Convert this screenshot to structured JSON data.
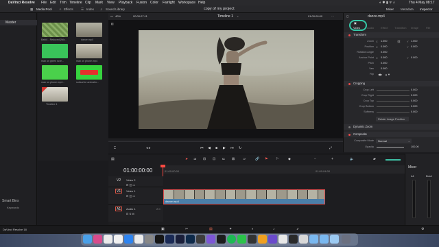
{
  "menubar": {
    "app_name": "DaVinci Resolve",
    "items": [
      "File",
      "Edit",
      "Trim",
      "Timeline",
      "Clip",
      "Mark",
      "View",
      "Playback",
      "Fusion",
      "Color",
      "Fairlight",
      "Workspace",
      "Help"
    ],
    "clock": "Thu 4 May  08:17"
  },
  "toolbar": {
    "media_pool": "Media Pool",
    "effects": "Effects",
    "index": "Index",
    "sound_library": "Sound Library",
    "project_title": "copy of my project",
    "mixer": "Mixer",
    "metadata": "Metadata",
    "inspector": "Inspector"
  },
  "bins": {
    "master": "Master",
    "smart_bins": "Smart Bins",
    "keywords": "Keywords"
  },
  "media_pool": {
    "clips": [
      {
        "label": "Bafd4 - Reduced [Wa...",
        "color": "#6b8f4a"
      },
      {
        "label": "dance.mp4",
        "color": "#9b9a8c"
      },
      {
        "label": "man on green scre...",
        "color": "#39c45a"
      },
      {
        "label": "man on phone.mp4",
        "color": "#b7b2a4"
      },
      {
        "label": "man on phone.mp4...",
        "color": "#4ad14b"
      },
      {
        "label": "subscribe animatio...",
        "color": "#37d23f"
      },
      {
        "label": "Timeline 1",
        "color": "#c9c6bc"
      }
    ]
  },
  "viewer": {
    "zoom": "40%",
    "source_tc": "00:00:07:11",
    "timeline_name": "Timeline 1",
    "record_tc": "01:00:00:00",
    "clip_name": "dance.mp4"
  },
  "inspector": {
    "tabs": [
      "Video",
      "Audio",
      "Effect",
      "Transition",
      "Image",
      "File"
    ],
    "active_tab": "Video",
    "transform_title": "Transform",
    "rows": [
      {
        "label": "Zoom",
        "x_label": "X",
        "x": "1.000",
        "y_label": "Y",
        "y": "1.000"
      },
      {
        "label": "Position",
        "x_label": "X",
        "x": "0.000",
        "y_label": "Y",
        "y": "0.000"
      },
      {
        "label": "Rotation Angle",
        "x": "0.000"
      },
      {
        "label": "Anchor Point",
        "x_label": "X",
        "x": "0.000",
        "y_label": "Y",
        "y": "0.000"
      },
      {
        "label": "Pitch",
        "x": "0.000"
      },
      {
        "label": "Yaw",
        "x": "0.000"
      },
      {
        "label": "Flip"
      }
    ],
    "cropping_title": "Cropping",
    "crop_rows": [
      {
        "label": "Crop Left",
        "x": "0.000"
      },
      {
        "label": "Crop Right",
        "x": "0.000"
      },
      {
        "label": "Crop Top",
        "x": "0.000"
      },
      {
        "label": "Crop Bottom",
        "x": "0.000"
      },
      {
        "label": "Softness",
        "x": "0.000"
      }
    ],
    "retain_label": "Retain Image Position",
    "dynamic_zoom_title": "Dynamic Zoom",
    "composite_title": "Composite",
    "composite_mode_label": "Composite Mode",
    "composite_mode_value": "Normal",
    "opacity_label": "Opacity",
    "opacity_value": "100.00",
    "highlight_color": "#35c9a8"
  },
  "timeline": {
    "timecode": "01:00:00:00",
    "ruler": [
      "01:00:00:00",
      "01:00:04:00"
    ],
    "tracks": [
      {
        "id": "V2",
        "name": "Video 2"
      },
      {
        "id": "V1",
        "name": "Video 1"
      },
      {
        "id": "A1",
        "name": "Audio 1",
        "level": "2.0"
      }
    ],
    "clip_name": "dance.mp4",
    "mixer_title": "Mixer",
    "mixer_channels": [
      "A1",
      "Bus1"
    ]
  },
  "bottombar": {
    "app_version": "DaVinci Resolve 18"
  }
}
